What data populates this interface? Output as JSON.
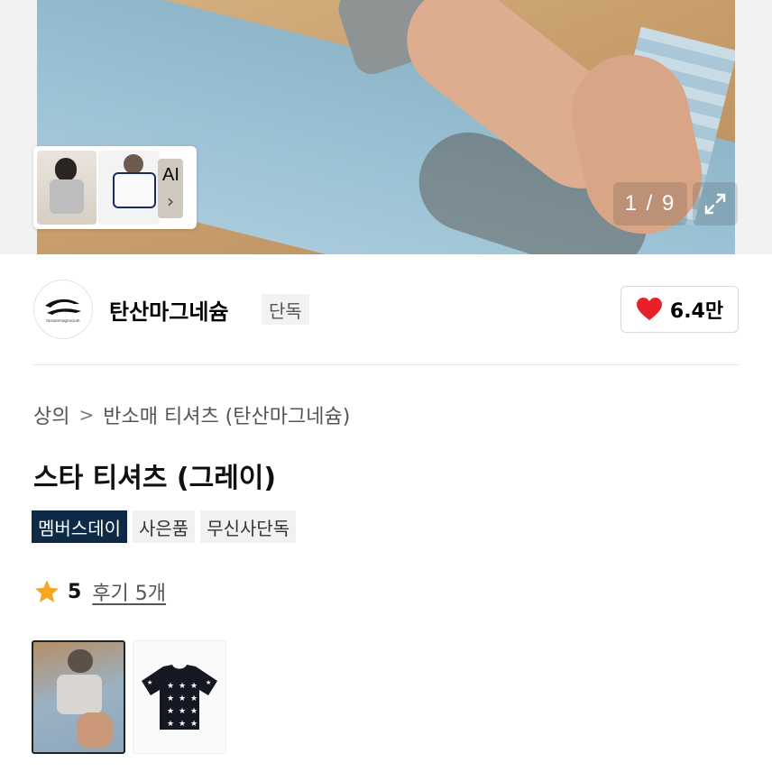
{
  "gallery": {
    "counter": "1 / 9",
    "ai_label": "AI"
  },
  "brand": {
    "name": "탄산마그네슘",
    "logo_text": "tansanmagnesium",
    "badge": "단독",
    "like_count": "6.4만"
  },
  "breadcrumb": {
    "items": [
      "상의",
      "반소매 티셔츠 (탄산마그네슘)"
    ],
    "separator": ">"
  },
  "product": {
    "title": "스타 티셔츠 (그레이)",
    "tags": [
      "멤버스데이",
      "사은품",
      "무신사단독"
    ],
    "rating": "5",
    "review_text": "후기 5개"
  },
  "colors": {
    "heart": "#e8202a",
    "star": "#f5a623",
    "tag_dark": "#0e2a47"
  },
  "icons": [
    "chevron-right-icon",
    "expand-icon",
    "heart-icon",
    "star-icon",
    "brand-logo-icon"
  ]
}
